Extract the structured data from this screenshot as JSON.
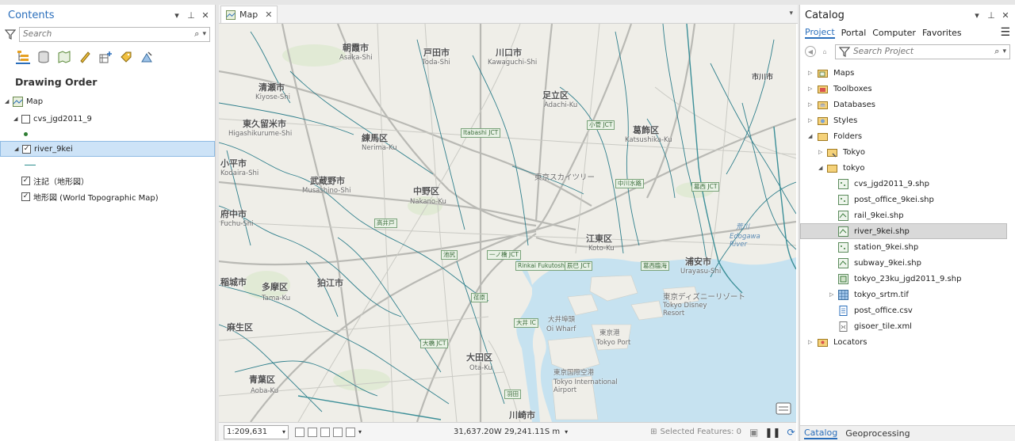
{
  "contents": {
    "title": "Contents",
    "search_placeholder": "Search",
    "heading": "Drawing Order",
    "layers": [
      {
        "label": "Map"
      },
      {
        "label": "cvs_jgd2011_9",
        "checked": false
      },
      {
        "label": "river_9kei",
        "checked": true
      },
      {
        "label": "注記（地形図）",
        "checked": true
      },
      {
        "label": "地形図 (World Topographic Map)",
        "checked": true
      }
    ]
  },
  "map": {
    "tab_label": "Map",
    "scale": "1:209,631",
    "coordinates": "31,637.20W 29,241.11S m",
    "selected_features": "Selected Features: 0",
    "labels": {
      "nerima": "練馬区",
      "nerima_en": "Nerima-Ku",
      "musashino": "武蔵野市",
      "musashino_en": "Musashino-Shi",
      "nakano": "中野区",
      "nakano_en": "Nakano-Ku",
      "adachi": "足立区",
      "adachi_en": "Adachi-Ku",
      "katsushika": "葛飾区",
      "katsushika_en": "Katsushika-Ku",
      "koto": "江東区",
      "koto_en": "Koto-Ku",
      "urayasu": "浦安市",
      "urayasu_en": "Urayasu-Shi",
      "ota": "大田区",
      "ota_en": "Ota-Ku",
      "kawaguchi": "川口市",
      "kawaguchi_en": "Kawaguchi-Shi",
      "toda": "戸田市",
      "toda_en": "Toda-Shi",
      "asaka": "朝霞市",
      "asaka_en": "Asaka-Shi",
      "kiyose": "清瀬市",
      "kiyose_en": "Kiyose-Shi",
      "higashikurume": "東久留米市",
      "higashikurume_en": "Higashikurume-Shi",
      "kodaira": "小平市",
      "kodaira_en": "Kodaira-Shi",
      "fuchu": "府中市",
      "fuchu_en": "Fuchu-Shi",
      "inagi": "稲城市",
      "tama": "多摩区",
      "tama_en": "Tama-Ku",
      "komae": "狛江市",
      "asao": "麻生区",
      "aoba": "青葉区",
      "aoba_en": "Aoba-Ku",
      "kawasaki": "川崎市",
      "disney": "東京ディズニーリゾート",
      "disney_en": "Tokyo Disney Resort",
      "airport": "東京国際空港",
      "airport_en": "Tokyo International Airport",
      "oi_wharf": "大井埠頭",
      "oi_wharf_en": "Oi Wharf",
      "tokyo_port": "東京港",
      "tokyo_port_en": "Tokyo Port",
      "skytree": "東京スカイツリー",
      "arakawa": "荒川",
      "edogawa_river": "Edogawa River",
      "nakagawa": "中川水路",
      "kasai": "葛西臨海",
      "ichikawa": "市川市",
      "jct_ohashi": "大橋 JCT",
      "jct_rinkai": "Rinkai Fukutoshin",
      "jct_haneda": "羽田",
      "jct_ebara": "荏原",
      "jct_ohi": "大井 IC",
      "jct_tatsumi": "辰巳 JCT",
      "jct_kosuge": "小菅 JCT",
      "jct_kasai": "葛西 JCT",
      "jct_itabashi": "Itabashi JCT",
      "jct_takaido": "高井戸",
      "jct_ikejiri": "池尻",
      "jct_ichinohashi": "一ノ橋 JCT"
    }
  },
  "catalog": {
    "title": "Catalog",
    "tabs": [
      "Project",
      "Portal",
      "Computer",
      "Favorites"
    ],
    "search_placeholder": "Search Project",
    "tree": [
      {
        "label": "Maps"
      },
      {
        "label": "Toolboxes"
      },
      {
        "label": "Databases"
      },
      {
        "label": "Styles"
      },
      {
        "label": "Folders"
      },
      {
        "label": "Tokyo"
      },
      {
        "label": "tokyo"
      },
      {
        "label": "cvs_jgd2011_9.shp"
      },
      {
        "label": "post_office_9kei.shp"
      },
      {
        "label": "rail_9kei.shp"
      },
      {
        "label": "river_9kei.shp"
      },
      {
        "label": "station_9kei.shp"
      },
      {
        "label": "subway_9kei.shp"
      },
      {
        "label": "tokyo_23ku_jgd2011_9.shp"
      },
      {
        "label": "tokyo_srtm.tif"
      },
      {
        "label": "post_office.csv"
      },
      {
        "label": "gisoer_tile.xml"
      },
      {
        "label": "Locators"
      }
    ],
    "bottom_tabs": [
      "Catalog",
      "Geoprocessing"
    ]
  }
}
